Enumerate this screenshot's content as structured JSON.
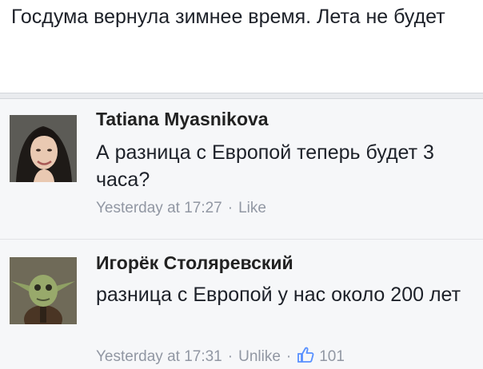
{
  "post": {
    "text": "Госдума вернула зимнее время. Лета не будет"
  },
  "comments": [
    {
      "author": "Tatiana Myasnikova",
      "text": "А разница с Европой теперь будет 3 часа?",
      "time": "Yesterday at 17:27",
      "separator": "·",
      "action": "Like"
    },
    {
      "author": "Игорёк Столяревский",
      "text": "разница с Европой у нас около 200 лет",
      "time": "Yesterday at 17:31",
      "separator": "·",
      "action": "Unlike",
      "likes": "101"
    }
  ],
  "colors": {
    "link": "#9197a3",
    "background": "#f6f7f9",
    "like_blue": "#5890ff"
  }
}
